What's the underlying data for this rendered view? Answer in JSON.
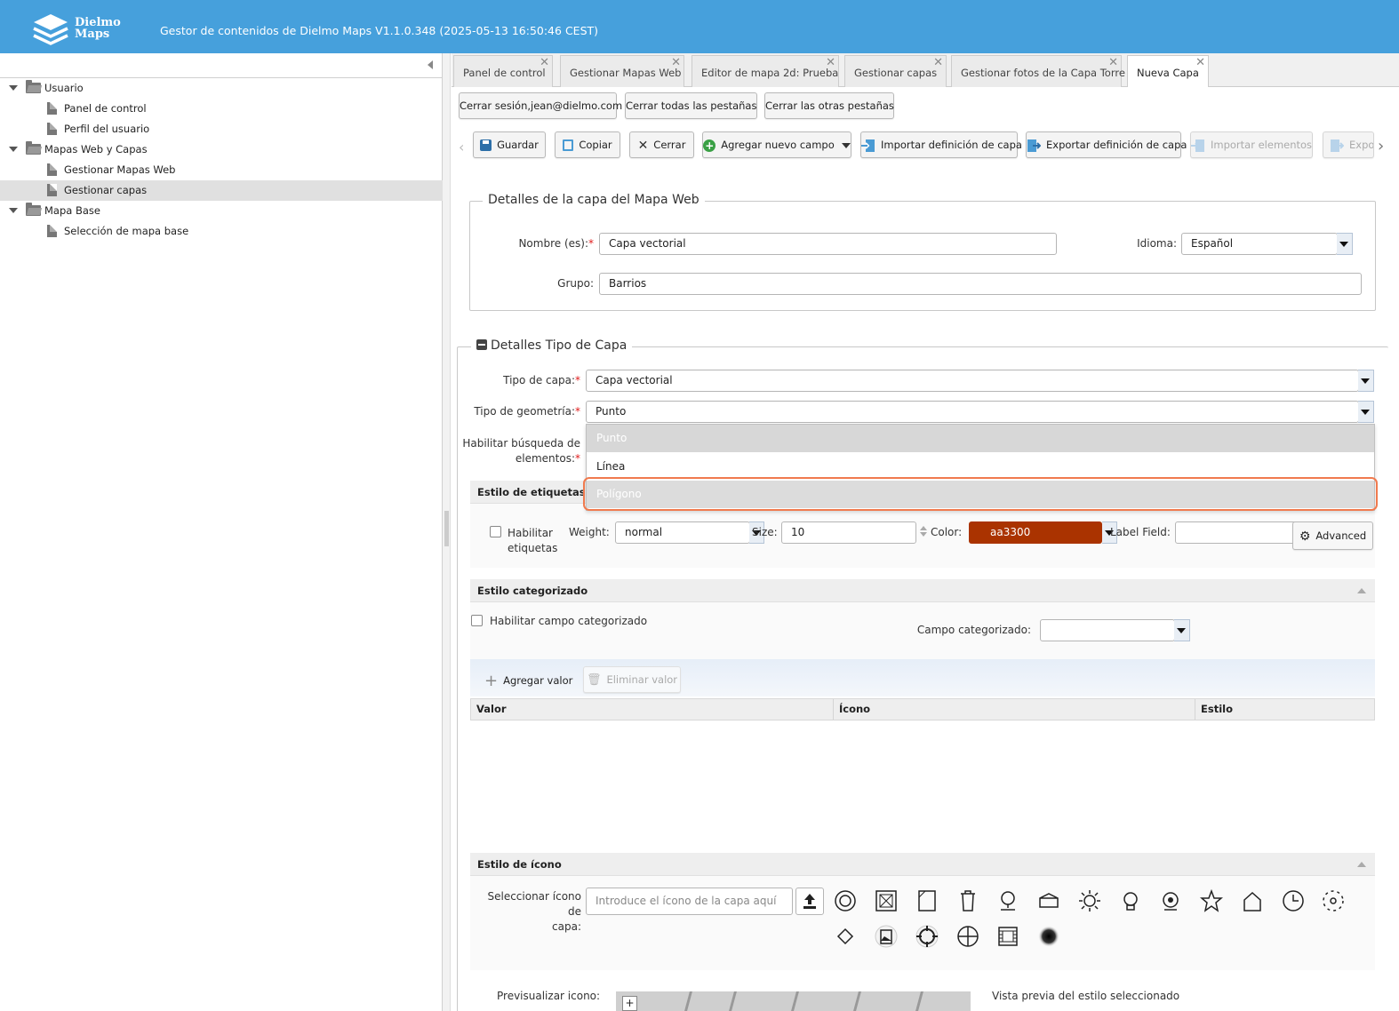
{
  "header": {
    "logo_line1": "Dielmo",
    "logo_line2": "Maps",
    "app_title": "Gestor de contenidos de Dielmo Maps V1.1.0.348 (2025-05-13 16:50:46 CEST)"
  },
  "tree": {
    "nodes": [
      {
        "label": "Usuario"
      },
      {
        "label": "Panel de control"
      },
      {
        "label": "Perfil del usuario"
      },
      {
        "label": "Mapas Web y Capas"
      },
      {
        "label": "Gestionar Mapas Web"
      },
      {
        "label": "Gestionar capas"
      },
      {
        "label": "Mapa Base"
      },
      {
        "label": "Selección de mapa base"
      }
    ]
  },
  "tabs": [
    {
      "label": "Panel de control"
    },
    {
      "label": "Gestionar Mapas Web"
    },
    {
      "label": "Editor de mapa 2d: Prueba"
    },
    {
      "label": "Gestionar capas"
    },
    {
      "label": "Gestionar fotos de la Capa Torre"
    },
    {
      "label": "Nueva Capa"
    }
  ],
  "tab_close_glyph": "✕",
  "session_buttons": {
    "logout": "Cerrar sesión,jean@dielmo.com",
    "close_all": "Cerrar todas las pestañas",
    "close_others": "Cerrar las otras pestañas"
  },
  "toolbar": {
    "save": "Guardar",
    "copy": "Copiar",
    "close": "Cerrar",
    "add_field": "Agregar nuevo campo",
    "import_def": "Importar definición de capa",
    "export_def": "Exportar definición de capa",
    "import_elements": "Importar elementos",
    "export_partial": "Expor"
  },
  "details": {
    "legend": "Detalles de la capa del Mapa Web",
    "name_label": "Nombre (es):",
    "name_value": "Capa vectorial",
    "language_label": "Idioma:",
    "language_value": "Español",
    "group_label": "Grupo:",
    "group_value": "Barrios"
  },
  "type_details": {
    "legend": "Detalles Tipo de Capa",
    "layer_type_label": "Tipo de capa:",
    "layer_type_value": "Capa vectorial",
    "geometry_label": "Tipo de geometría:",
    "geometry_value": "Punto",
    "search_label_1": "Habilitar búsqueda de",
    "search_label_2": "elementos:",
    "geometry_options": [
      "Punto",
      "Línea",
      "Polígono"
    ],
    "required_mark": "*"
  },
  "label_style": {
    "title": "Estilo de etiquetas",
    "enable_1": "Habilitar",
    "enable_2": "etiquetas",
    "weight_label": "Weight:",
    "weight_value": "normal",
    "size_label": "Size:",
    "size_value": "10",
    "color_label": "Color:",
    "color_value": "aa3300",
    "color_hex": "#aa3300",
    "label_field_label": "Label Field:",
    "advanced": "Advanced"
  },
  "categorized": {
    "title": "Estilo categorizado",
    "enable": "Habilitar campo categorizado",
    "field_label": "Campo categorizado:",
    "add_value": "Agregar valor",
    "remove_value": "Eliminar valor",
    "columns": [
      "Valor",
      "Ícono",
      "Estilo"
    ]
  },
  "icon_style": {
    "title": "Estilo de ícono",
    "select_label_1": "Seleccionar ícono de",
    "select_label_2": "capa:",
    "placeholder": "Introduce el ícono de la capa aquí",
    "icons": [
      "circle-target-icon",
      "boxed-x-icon",
      "page-corner-icon",
      "trash-bin-icon",
      "location-pin-icon",
      "open-box-icon",
      "sun-icon",
      "bulb-pin-icon",
      "webcam-icon",
      "star-icon",
      "home-icon",
      "clock-icon",
      "dotted-circle-icon",
      "diamond-icon",
      "photo-pin-icon",
      "crosshair-icon",
      "globe-cross-icon",
      "film-frame-icon",
      "blur-dot-icon"
    ]
  },
  "preview": {
    "icon_label": "Previsualizar icono:",
    "style_label": "Vista previa del estilo seleccionado",
    "zoom_in": "+"
  }
}
